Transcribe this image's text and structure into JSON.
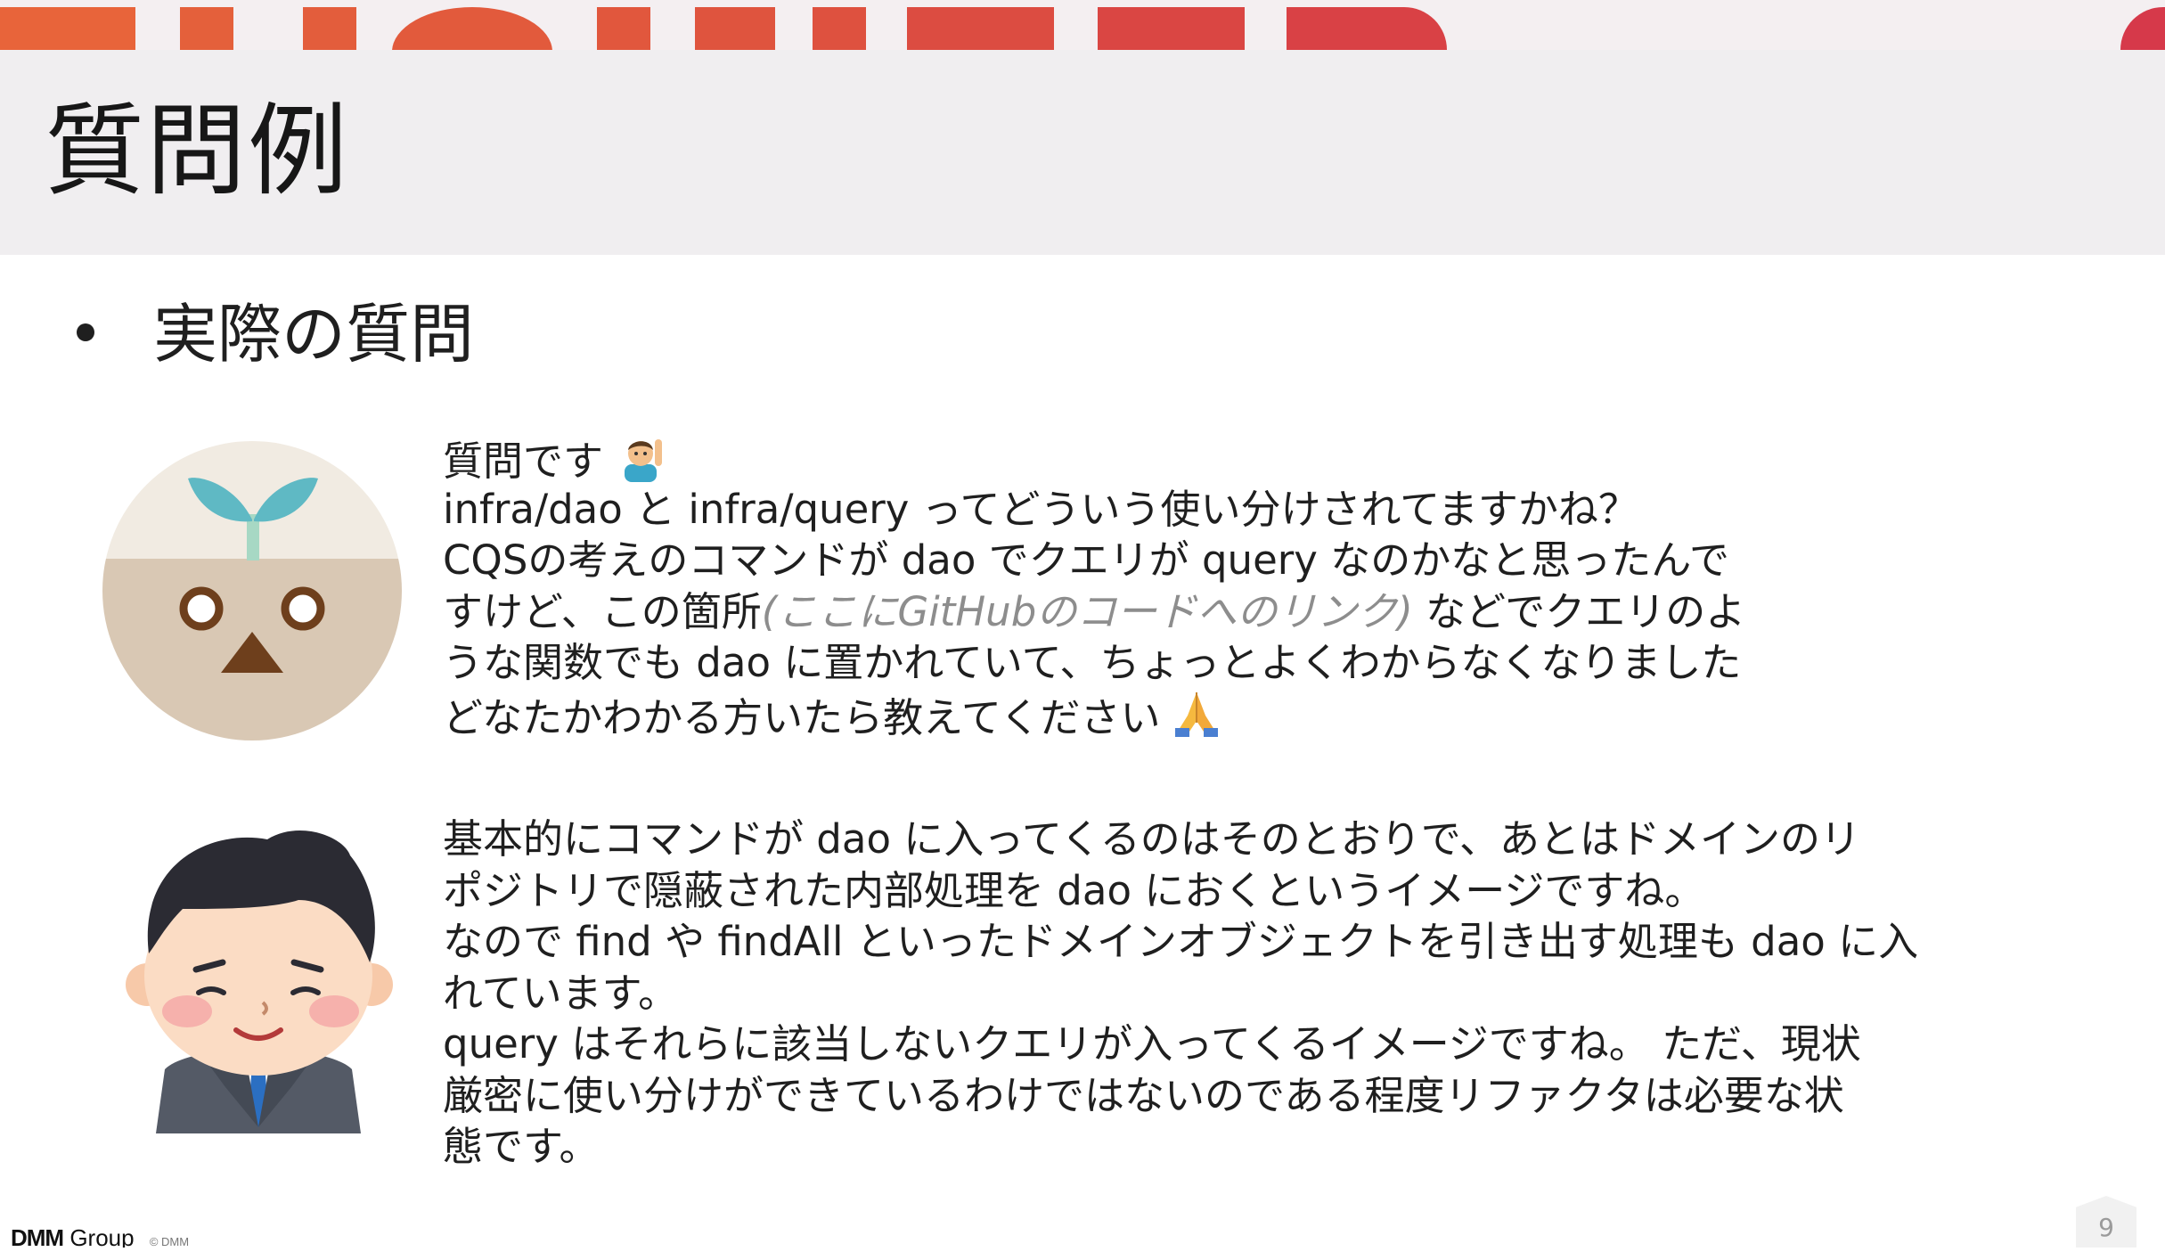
{
  "slide": {
    "title": "質問例",
    "bullet": "実際の質問",
    "page_number": "9"
  },
  "question": {
    "avatar_icon": "sprout-face-avatar-icon",
    "lines": [
      "質問です",
      "infra/dao と infra/query ってどういう使い分けされてますかね？",
      "CQSの考えのコマンドが dao でクエリが query なのかなと思ったんで",
      "すけど、この箇所",
      "(ここにGitHubのコードへのリンク)",
      " などでクエリのよ",
      "うな関数でも dao に置かれていて、ちょっとよくわからなくなりました",
      "どなたかわかる方いたら教えてください"
    ],
    "emoji_1": "person-raising-hand-icon",
    "emoji_2": "folded-hands-icon"
  },
  "answer": {
    "avatar_icon": "businessman-avatar-icon",
    "lines": [
      "基本的にコマンドが dao に入ってくるのはそのとおりで、あとはドメインのリ",
      "ポジトリで隠蔽された内部処理を dao におくというイメージですね。",
      "なので find や findAll といったドメインオブジェクトを引き出す処理も dao に入",
      "れています。",
      "query はそれらに該当しないクエリが入ってくるイメージですね。 ただ、現状",
      "厳密に使い分けができているわけではないのである程度リファクタは必要な状",
      "態です。"
    ]
  },
  "footer": {
    "logo_text": "DMM",
    "logo_suffix": "Group",
    "copyright": "© DMM"
  },
  "colors": {
    "band_orange": "#e8623a",
    "band_red": "#d8364a",
    "title_bg": "#f0eef0",
    "link_gray": "#8d8d8d"
  }
}
